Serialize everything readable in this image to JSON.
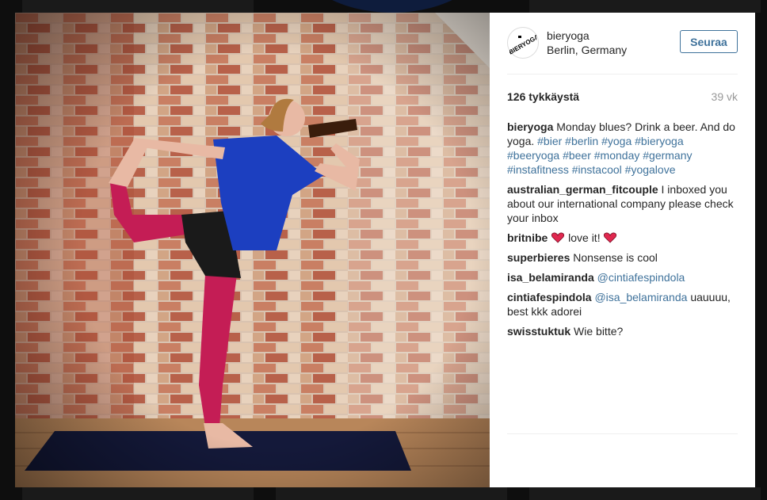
{
  "post": {
    "avatar_logo": "BIERYOGA",
    "username": "bieryoga",
    "location": "Berlin, Germany",
    "follow_label": "Seuraa",
    "likes": "126 tykkäystä",
    "time_ago": "39 vk",
    "photo_icon": "woman-yoga-pose-drinking-beer-photo"
  },
  "caption": {
    "user": "bieryoga",
    "text": "Monday blues? Drink a beer. And do yoga.",
    "hashtags": [
      "#bier",
      "#berlin",
      "#yoga",
      "#bieryoga",
      "#beeryoga",
      "#beer",
      "#monday",
      "#germany",
      "#instafitness",
      "#instacool",
      "#yogalove"
    ]
  },
  "comments": [
    {
      "user": "australian_german_fitcouple",
      "text": "I inboxed you about our international company please check your inbox"
    },
    {
      "user": "britnibe",
      "text": "love it!"
    },
    {
      "user": "superbieres",
      "text": "Nonsense is cool"
    },
    {
      "user": "isa_belamiranda",
      "mention": "@cintiafespindola"
    },
    {
      "user": "cintiafespindola",
      "mention": "@isa_belamiranda",
      "text": "uauuuu, best kkk adorei"
    },
    {
      "user": "swisstuktuk",
      "text": "Wie bitte?"
    }
  ],
  "colors": {
    "link": "#3f729b",
    "heart": "#e0284f",
    "text": "#262626",
    "muted": "#999999"
  }
}
